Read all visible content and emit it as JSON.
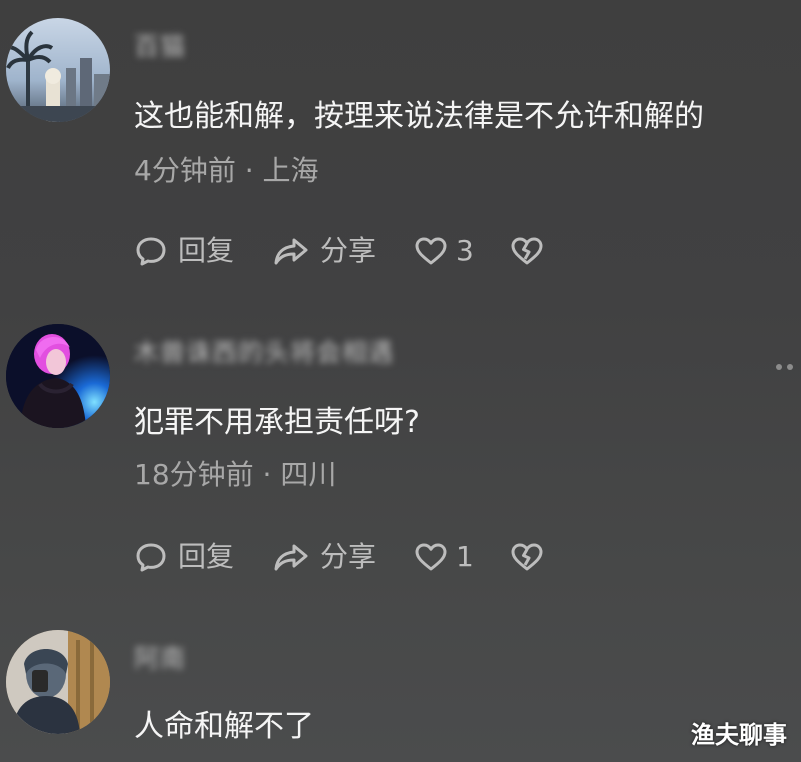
{
  "comments": [
    {
      "username": "百猫",
      "text": "这也能和解，按理来说法律是不允许和解的",
      "meta": "4分钟前 · 上海",
      "reply_label": "回复",
      "share_label": "分享",
      "likes": "3"
    },
    {
      "username": "木兽诛西的头将会相遇",
      "text": "犯罪不用承担责任呀?",
      "meta": "18分钟前 · 四川",
      "reply_label": "回复",
      "share_label": "分享",
      "likes": "1"
    },
    {
      "username": "阿南",
      "text": "人命和解不了"
    }
  ],
  "watermark": "渔夫聊事",
  "icons": {
    "reply": "comment-bubble-icon",
    "share": "share-arrow-icon",
    "like": "heart-icon",
    "dislike": "broken-heart-icon",
    "more": "more-dots-icon"
  },
  "colors": {
    "background": "#414142",
    "text": "#f5f5f5",
    "secondary_text": "#a8a8a8",
    "icon": "#bdbdbd"
  }
}
